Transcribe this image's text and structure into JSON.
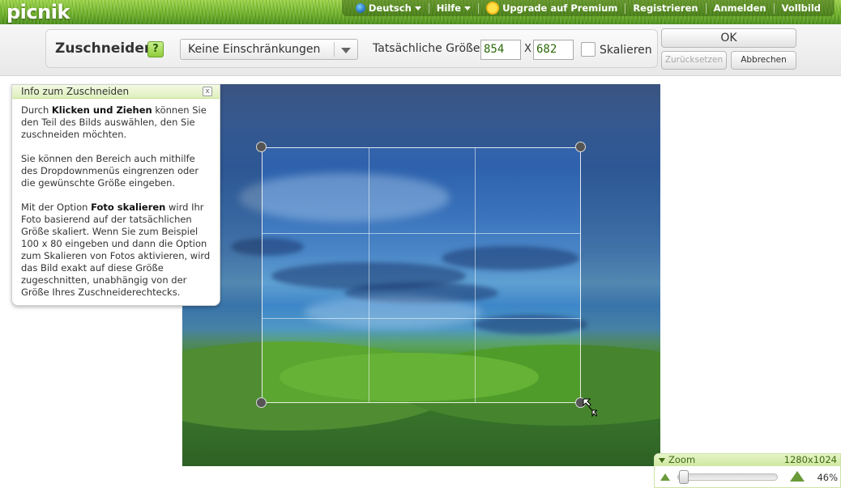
{
  "app": {
    "logo": "picnik"
  },
  "topnav": {
    "language": "Deutsch",
    "help": "Hilfe",
    "upgrade": "Upgrade auf Premium",
    "register": "Registrieren",
    "login": "Anmelden",
    "fullscreen": "Vollbild"
  },
  "toolbar": {
    "title": "Zuschneiden",
    "help_label": "?",
    "constraint": "Keine Einschränkungen",
    "size_label": "Tatsächliche Größe:",
    "width": "854",
    "separator": "X",
    "height": "682",
    "scale_label": "Skalieren",
    "scale_checked": false,
    "ok_label": "OK",
    "reset_label": "Zurücksetzen",
    "cancel_label": "Abbrechen"
  },
  "info_panel": {
    "title": "Info zum Zuschneiden",
    "close_label": "x",
    "p1_pre": "Durch ",
    "p1_bold": "Klicken und Ziehen",
    "p1_post": " können Sie den Teil des Bilds auswählen, den Sie zuschneiden möchten.",
    "p2": "Sie können den Bereich auch mithilfe des Dropdownmenüs eingrenzen oder die gewünschte Größe eingeben.",
    "p3_pre": "Mit der Option ",
    "p3_bold": "Foto skalieren",
    "p3_post": " wird Ihr Foto basierend auf der tatsächlichen Größe skaliert. Wenn Sie zum Beispiel 100 x 80 eingeben und dann die Option zum Skalieren von Fotos aktivieren, wird das Bild exakt auf diese Größe zugeschnitten, unabhängig von der Größe Ihres Zuschneiderechtecks."
  },
  "zoom": {
    "title": "Zoom",
    "dimensions": "1280x1024",
    "percent": "46%",
    "level": 0.05
  },
  "colors": {
    "accent_green": "#8fcc3c",
    "panel_header": "#dff0bd",
    "value_text": "#2b6a08"
  },
  "icons": [
    "globe-icon",
    "chevron-down-icon",
    "sun-icon",
    "help-icon",
    "close-icon",
    "mountain-small-icon",
    "mountain-large-icon",
    "resize-cursor-icon"
  ]
}
